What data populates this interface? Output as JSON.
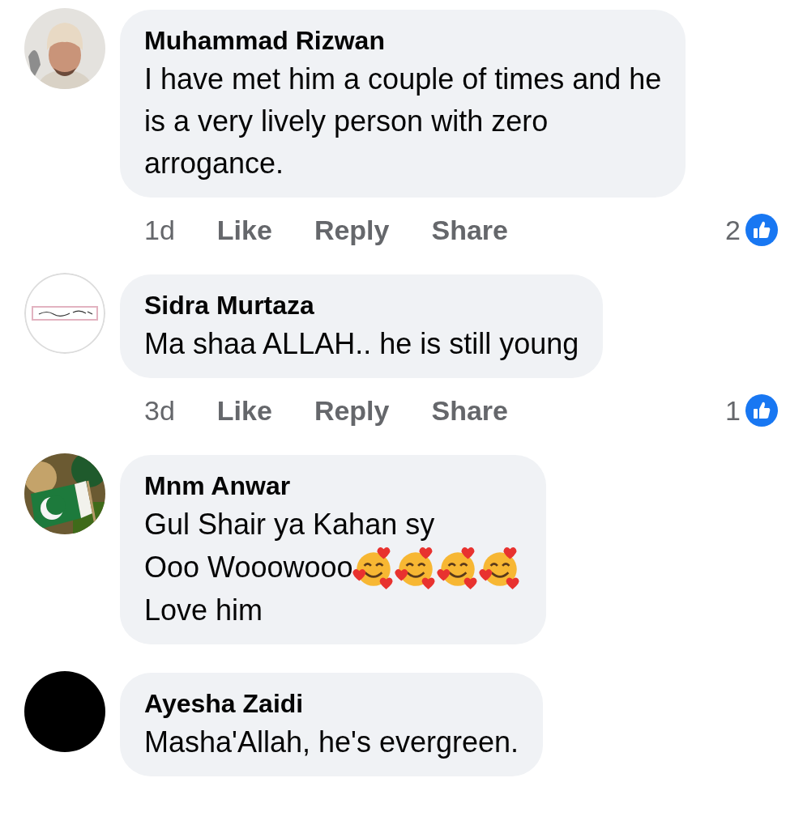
{
  "comments": [
    {
      "author": "Muhammad Rizwan",
      "body": [
        {
          "text": "I have met him a couple of times and he"
        },
        {
          "text": "is a very lively person with zero"
        },
        {
          "text": "arrogance."
        }
      ],
      "time": "1d",
      "actions": [
        "Like",
        "Reply",
        "Share"
      ],
      "reaction_count": "2"
    },
    {
      "author": "Sidra Murtaza",
      "body": [
        {
          "text": "Ma shaa ALLAH.. he is still young"
        }
      ],
      "time": "3d",
      "actions": [
        "Like",
        "Reply",
        "Share"
      ],
      "reaction_count": "1"
    },
    {
      "author": "Mnm Anwar",
      "body": [
        {
          "text": "Gul Shair ya Kahan sy"
        },
        {
          "text": "Ooo Wooowooo",
          "emojis": [
            {
              "kind": "smiling-face-with-hearts"
            },
            {
              "kind": "smiling-face-with-hearts"
            },
            {
              "kind": "smiling-face-with-hearts"
            },
            {
              "kind": "smiling-face-with-hearts"
            }
          ]
        },
        {
          "text": "Love him"
        }
      ]
    },
    {
      "author": "Ayesha Zaidi",
      "body": [
        {
          "text": "Masha'Allah, he's evergreen."
        }
      ]
    }
  ]
}
